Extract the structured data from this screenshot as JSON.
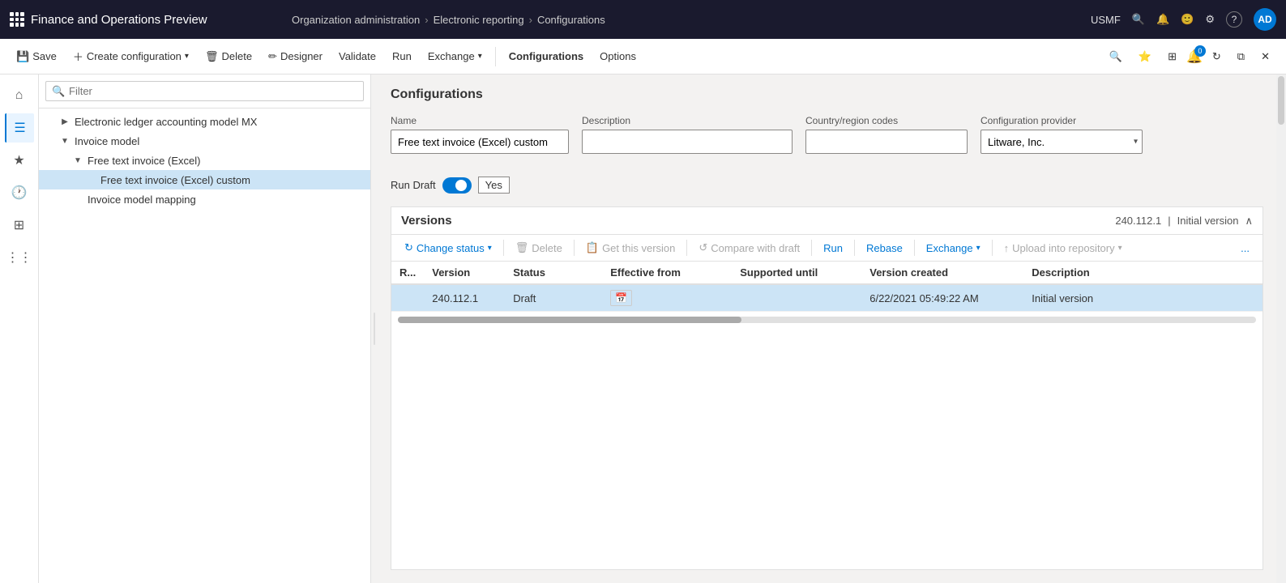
{
  "app": {
    "title": "Finance and Operations Preview"
  },
  "breadcrumb": {
    "items": [
      {
        "label": "Organization administration"
      },
      {
        "label": "Electronic reporting"
      },
      {
        "label": "Configurations"
      }
    ]
  },
  "topbar": {
    "company": "USMF",
    "avatar": "AD",
    "icons": {
      "search": "🔍",
      "bell": "🔔",
      "smiley": "🙂",
      "gear": "⚙",
      "help": "?",
      "badge": "0"
    }
  },
  "toolbar": {
    "save": "Save",
    "create_config": "Create configuration",
    "delete": "Delete",
    "designer": "Designer",
    "validate": "Validate",
    "run": "Run",
    "exchange": "Exchange",
    "configurations": "Configurations",
    "options": "Options"
  },
  "tree": {
    "filter_placeholder": "Filter",
    "items": [
      {
        "id": "elam",
        "label": "Electronic ledger accounting model MX",
        "indent": 1,
        "expanded": false
      },
      {
        "id": "invoice-model",
        "label": "Invoice model",
        "indent": 1,
        "expanded": true
      },
      {
        "id": "fti-excel",
        "label": "Free text invoice (Excel)",
        "indent": 2,
        "expanded": true
      },
      {
        "id": "fti-excel-custom",
        "label": "Free text invoice (Excel) custom",
        "indent": 3,
        "selected": true
      },
      {
        "id": "invoice-mapping",
        "label": "Invoice model mapping",
        "indent": 2,
        "expanded": false
      }
    ]
  },
  "content": {
    "section_title": "Configurations",
    "fields": {
      "name_label": "Name",
      "name_value": "Free text invoice (Excel) custom",
      "description_label": "Description",
      "description_value": "",
      "country_label": "Country/region codes",
      "country_value": "",
      "provider_label": "Configuration provider",
      "provider_value": "Litware, Inc.",
      "run_draft_label": "Run Draft",
      "run_draft_value": "Yes",
      "run_draft_on": true
    },
    "versions": {
      "title": "Versions",
      "meta_version": "240.112.1",
      "meta_label": "Initial version",
      "toolbar": {
        "change_status": "Change status",
        "delete": "Delete",
        "get_this_version": "Get this version",
        "compare_with_draft": "Compare with draft",
        "run": "Run",
        "rebase": "Rebase",
        "exchange": "Exchange",
        "upload_into_repo": "Upload into repository",
        "more": "..."
      },
      "table": {
        "headers": [
          "R...",
          "Version",
          "Status",
          "Effective from",
          "Supported until",
          "Version created",
          "Description"
        ],
        "rows": [
          {
            "r": "",
            "version": "240.112.1",
            "status": "Draft",
            "effective_from": "",
            "supported_until": "",
            "version_created": "6/22/2021 05:49:22 AM",
            "description": "Initial version",
            "selected": true
          }
        ]
      }
    }
  }
}
